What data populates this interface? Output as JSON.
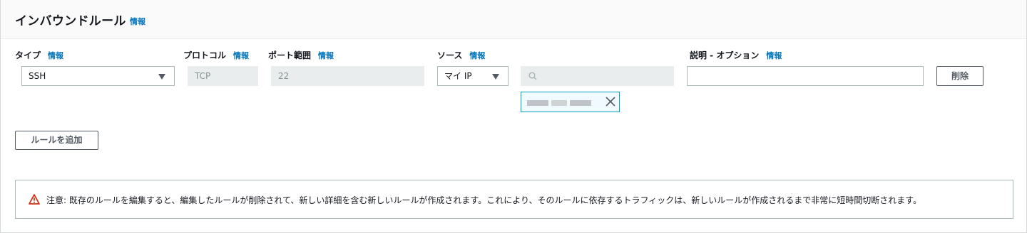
{
  "header": {
    "title": "インバウンドルール",
    "info": "情報"
  },
  "columns": {
    "type": {
      "label": "タイプ",
      "info": "情報"
    },
    "protocol": {
      "label": "プロトコル",
      "info": "情報"
    },
    "port_range": {
      "label": "ポート範囲",
      "info": "情報"
    },
    "source": {
      "label": "ソース",
      "info": "情報"
    },
    "description": {
      "label": "説明 - オプション",
      "info": "情報"
    }
  },
  "rule": {
    "type_value": "SSH",
    "protocol_value": "TCP",
    "port_value": "22",
    "source_value": "マイ IP",
    "cidr_search_value": "",
    "description_value": "",
    "delete_label": "削除"
  },
  "add_rule_label": "ルールを追加",
  "alert": {
    "icon": "warning-icon",
    "text": "注意: 既存のルールを編集すると、編集したルールが削除されて、新しい詳細を含む新しいルールが作成されます。これにより、そのルールに依存するトラフィックは、新しいルールが作成されるまで非常に短時間切断されます。"
  },
  "colors": {
    "link": "#0073bb",
    "warning": "#d13212",
    "token_border": "#00a1c9"
  }
}
